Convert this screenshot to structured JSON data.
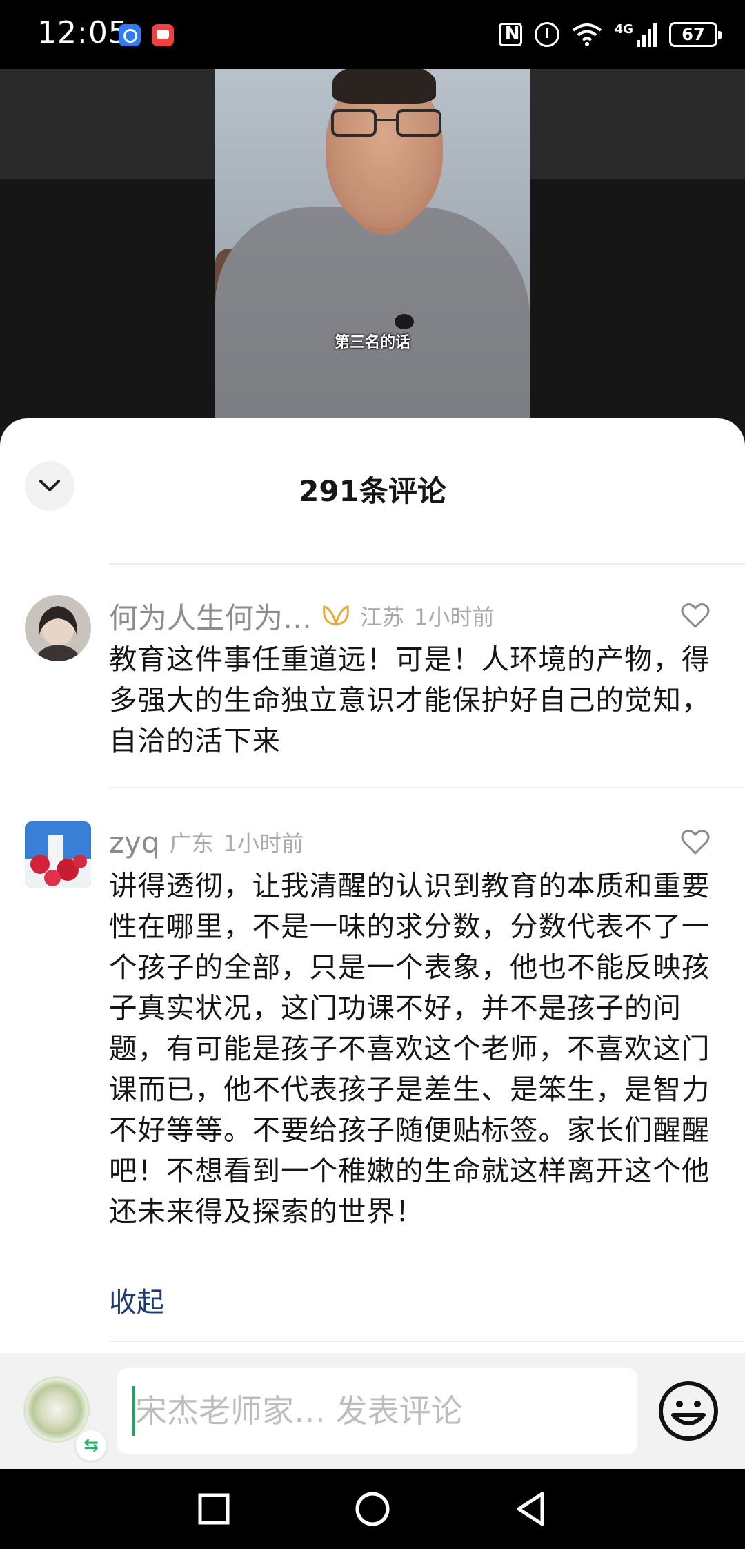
{
  "status_bar": {
    "time": "12:05",
    "network": "4G",
    "battery": "67"
  },
  "video": {
    "subtitle": "第三名的话"
  },
  "comments_panel": {
    "title": "291条评论",
    "comments": [
      {
        "user": "何为人生何为…",
        "location": "江苏",
        "time": "1小时前",
        "text": "教育这件事任重道远！可是！人环境的产物，得多强大的生命独立意识才能保护好自己的觉知，自洽的活下来"
      },
      {
        "user": "zyq",
        "location": "广东",
        "time": "1小时前",
        "text": "讲得透彻，让我清醒的认识到教育的本质和重要性在哪里，不是一味的求分数，分数代表不了一个孩子的全部，只是一个表象，他也不能反映孩子真实状况，这门功课不好，并不是孩子的问题，有可能是孩子不喜欢这个老师，不喜欢这门课而已，他不代表孩子是差生、是笨生，是智力不好等等。不要给孩子随便贴标签。家长们醒醒吧！不想看到一个稚嫩的生命就这样离开这个他还未来得及探索的世界！",
        "collapse_label": "收起"
      }
    ]
  },
  "input_bar": {
    "placeholder": "宋杰老师家… 发表评论"
  },
  "colors": {
    "accent_link": "#1f3c6e",
    "badge_gold": "#e8a93a",
    "caret_green": "#1fa463"
  }
}
